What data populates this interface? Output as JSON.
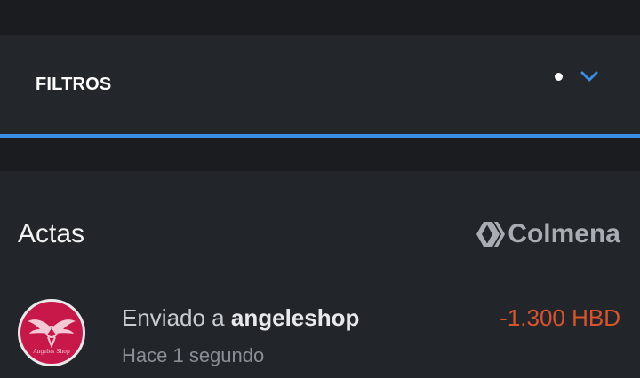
{
  "filters": {
    "label": "FILTROS"
  },
  "section": {
    "title": "Actas",
    "brand_name": "Colmena"
  },
  "transaction": {
    "description_prefix": "Enviado a",
    "username": "angeleshop",
    "time": "Hace 1 segundo",
    "amount": "-1.300 HBD",
    "avatar_text": "Angeles Shop"
  },
  "colors": {
    "accent": "#3a8ee6",
    "negative_amount": "#d9532b",
    "avatar_background": "#c8184a"
  },
  "icons": {
    "indicator": "dot-icon",
    "expand": "chevron-down-icon",
    "brand": "hive-logo-icon",
    "avatar": "angel-wings-logo"
  }
}
